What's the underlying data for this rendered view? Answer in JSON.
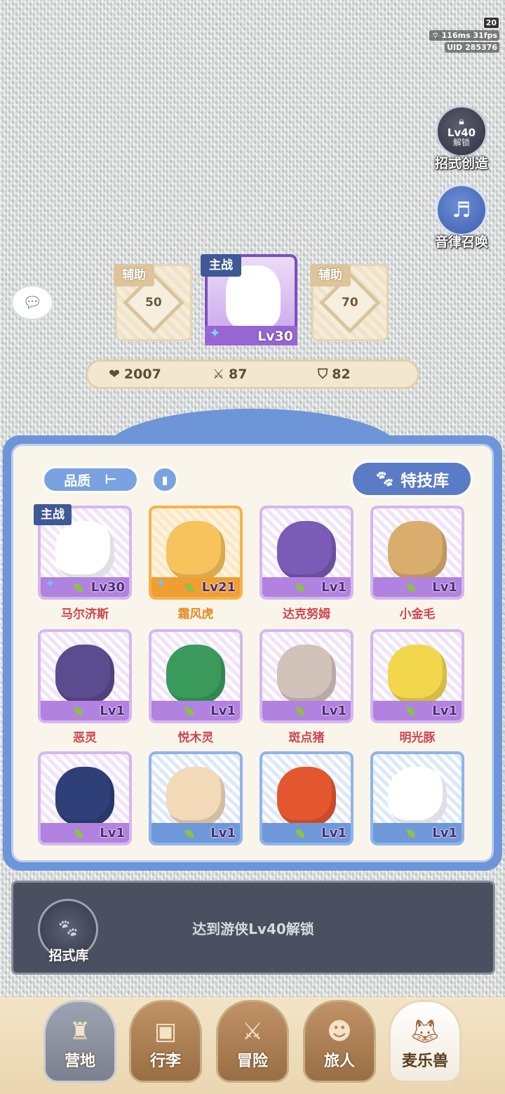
{
  "status": {
    "battery": "20",
    "ping": "116ms",
    "fps": "31fps",
    "uid": "UID 285376"
  },
  "side": {
    "skill_create": {
      "lv": "Lv40",
      "unlock": "解锁",
      "label": "招式创造"
    },
    "summon": {
      "label": "音律召唤"
    }
  },
  "team": {
    "left": {
      "tag": "辅助",
      "level": "50"
    },
    "main": {
      "tag": "主战",
      "level": "Lv30"
    },
    "right": {
      "tag": "辅助",
      "level": "70"
    }
  },
  "stats": {
    "hp": "2007",
    "attack": "87",
    "defense": "82"
  },
  "panel": {
    "filter": "品质",
    "skill_lib": "特技库",
    "main_tag": "主战"
  },
  "pets": [
    {
      "name": "马尔济斯",
      "lv": "Lv30",
      "rarity": "purple",
      "color": "#ffffff"
    },
    {
      "name": "霜风虎",
      "lv": "Lv21",
      "rarity": "orange",
      "color": "#f6c35c"
    },
    {
      "name": "达克努姆",
      "lv": "Lv1",
      "rarity": "purple",
      "color": "#7a5bb5"
    },
    {
      "name": "小金毛",
      "lv": "Lv1",
      "rarity": "purple",
      "color": "#d8ad6d"
    },
    {
      "name": "恶灵",
      "lv": "Lv1",
      "rarity": "purple",
      "color": "#5b4b8f"
    },
    {
      "name": "悦木灵",
      "lv": "Lv1",
      "rarity": "purple",
      "color": "#3a9a5c"
    },
    {
      "name": "斑点猪",
      "lv": "Lv1",
      "rarity": "purple",
      "color": "#d1c3ba"
    },
    {
      "name": "明光豚",
      "lv": "Lv1",
      "rarity": "purple",
      "color": "#f2d64c"
    },
    {
      "name": "",
      "lv": "Lv1",
      "rarity": "purple",
      "color": "#2f3f78"
    },
    {
      "name": "",
      "lv": "Lv1",
      "rarity": "blue",
      "color": "#f2d9b8"
    },
    {
      "name": "",
      "lv": "Lv1",
      "rarity": "blue",
      "color": "#e4572e"
    },
    {
      "name": "",
      "lv": "Lv1",
      "rarity": "blue",
      "color": "#ffffff"
    }
  ],
  "lock": {
    "text": "达到游侠Lv40解锁",
    "label": "招式库"
  },
  "nav": {
    "camp": "营地",
    "bag": "行李",
    "adventure": "冒险",
    "traveler": "旅人",
    "pets": "麦乐兽"
  }
}
